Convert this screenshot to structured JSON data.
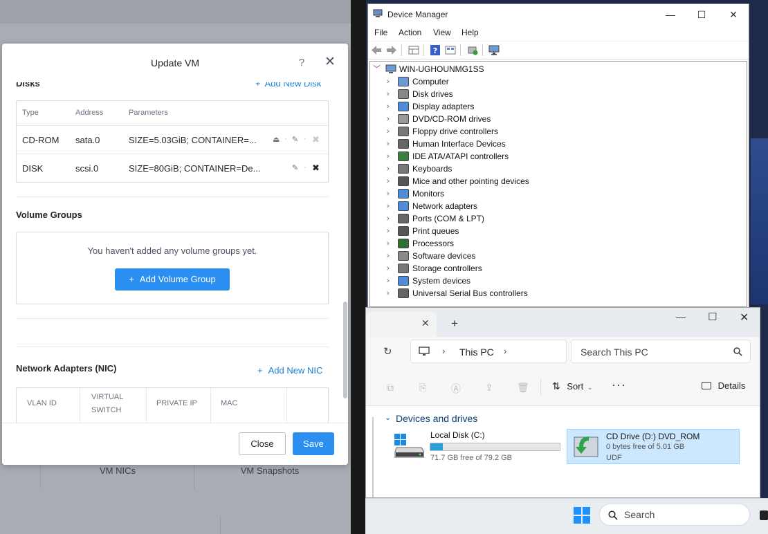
{
  "prism": {
    "bg_tabs": [
      "VM NICs",
      "VM Snapshots"
    ]
  },
  "modal": {
    "title": "Update VM",
    "disks": {
      "title": "Disks",
      "add_label": "Add New Disk",
      "columns": [
        "Type",
        "Address",
        "Parameters"
      ],
      "rows": [
        {
          "type": "CD-ROM",
          "address": "sata.0",
          "parameters": "SIZE=5.03GiB; CONTAINER=..."
        },
        {
          "type": "DISK",
          "address": "scsi.0",
          "parameters": "SIZE=80GiB; CONTAINER=De..."
        }
      ]
    },
    "volume_groups": {
      "title": "Volume Groups",
      "empty_text": "You haven't added any volume groups yet.",
      "add_button": "Add Volume Group"
    },
    "nic": {
      "title": "Network Adapters (NIC)",
      "add_label": "Add New NIC",
      "columns": [
        "VLAN ID",
        "VIRTUAL",
        "SWITCH",
        "PRIVATE IP",
        "MAC"
      ]
    },
    "footer": {
      "close_label": "Close",
      "save_label": "Save"
    }
  },
  "device_manager": {
    "title": "Device Manager",
    "menus": [
      "File",
      "Action",
      "View",
      "Help"
    ],
    "root": "WIN-UGHOUNMG1SS",
    "items": [
      "Computer",
      "Disk drives",
      "Display adapters",
      "DVD/CD-ROM drives",
      "Floppy drive controllers",
      "Human Interface Devices",
      "IDE ATA/ATAPI controllers",
      "Keyboards",
      "Mice and other pointing devices",
      "Monitors",
      "Network adapters",
      "Ports (COM & LPT)",
      "Print queues",
      "Processors",
      "Software devices",
      "Storage controllers",
      "System devices",
      "Universal Serial Bus controllers"
    ]
  },
  "explorer": {
    "breadcrumb": "This PC",
    "search_placeholder": "Search This PC",
    "sort_label": "Sort",
    "details_label": "Details",
    "group_title": "Devices and drives",
    "drives": [
      {
        "name": "Local Disk (C:)",
        "free": "71.7 GB free of 79.2 GB",
        "used_fraction": 0.095
      },
      {
        "name": "CD Drive (D:) DVD_ROM",
        "free": "0 bytes free of 5.01 GB",
        "fs": "UDF"
      }
    ]
  },
  "taskbar": {
    "search_placeholder": "Search"
  },
  "colors": {
    "accent": "#2a8ff0",
    "link": "#1b7fd8",
    "win_accent": "#0067c0"
  }
}
